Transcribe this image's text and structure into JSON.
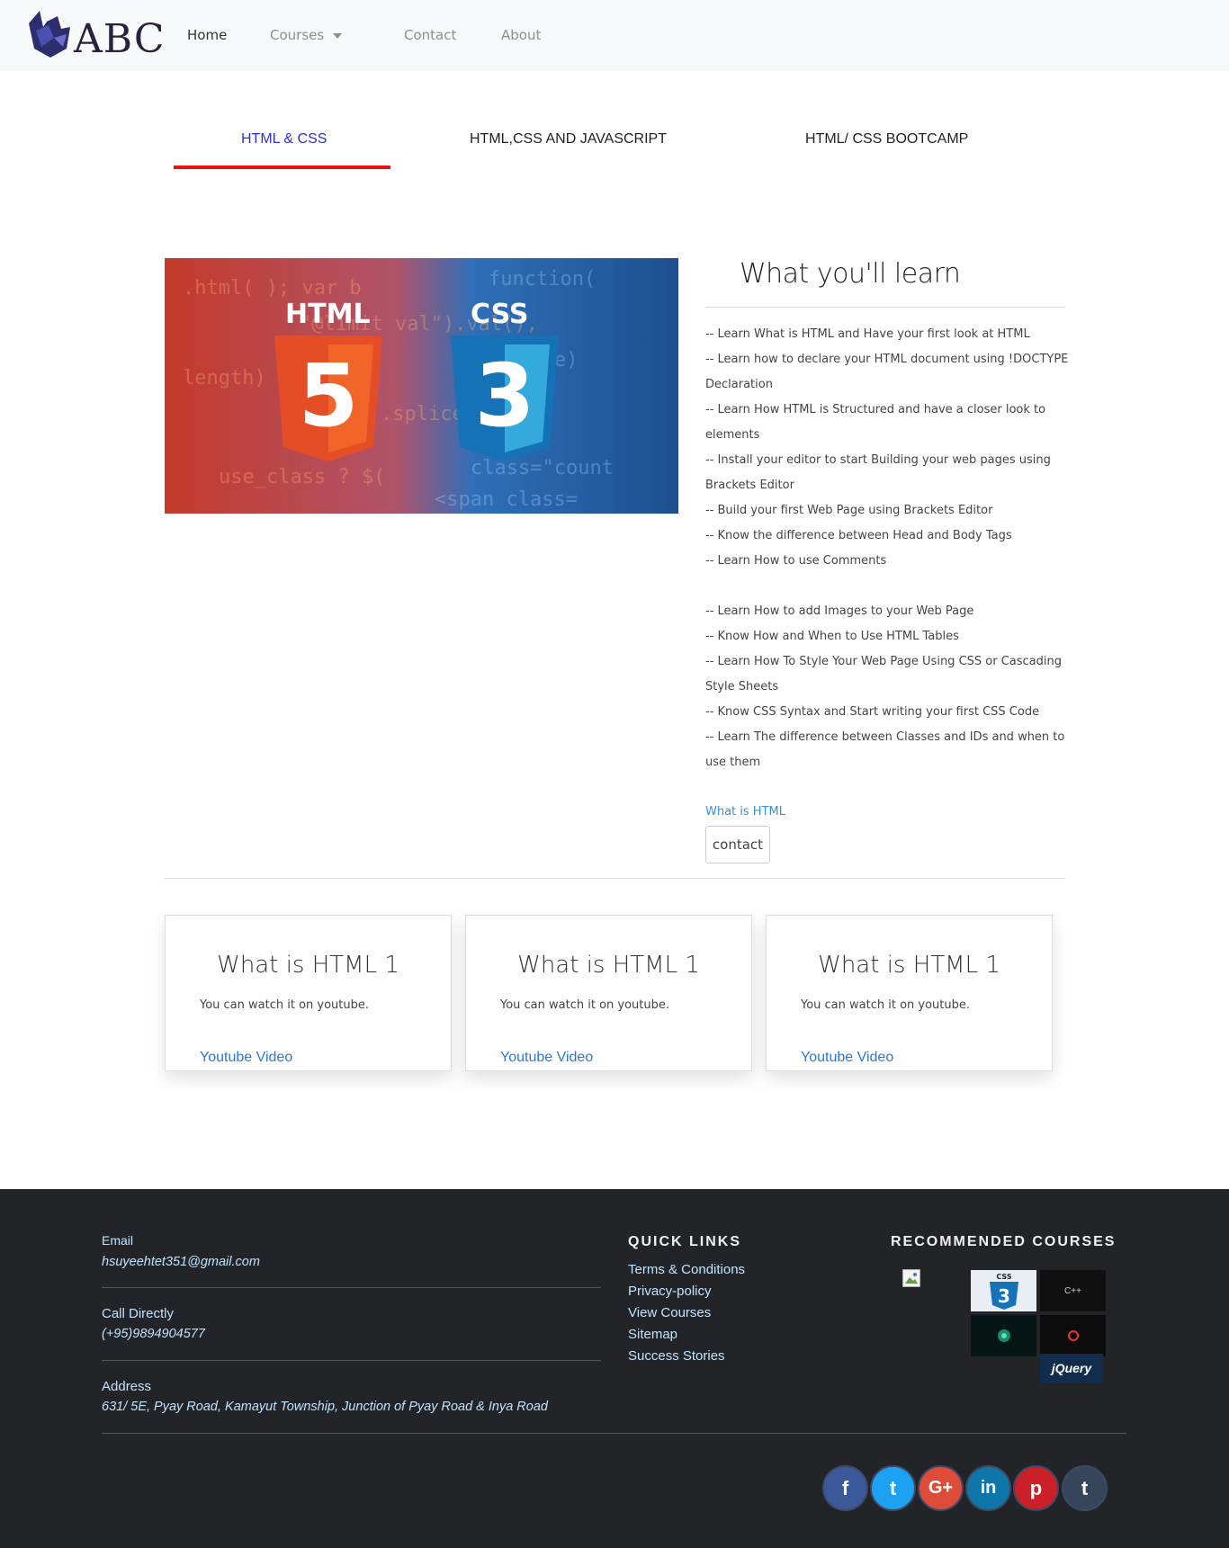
{
  "nav": {
    "logo_text": "ABC",
    "home": "Home",
    "courses": "Courses",
    "contact": "Contact",
    "about": "About"
  },
  "tabs": [
    {
      "label": "HTML & CSS",
      "active": true
    },
    {
      "label": "HTML,CSS AND JAVASCRIPT",
      "active": false
    },
    {
      "label": "HTML/ CSS BOOTCAMP",
      "active": false
    }
  ],
  "hero": {
    "html_label": "HTML",
    "html_num": "5",
    "css_label": "CSS",
    "css_num": "3"
  },
  "learn": {
    "title": "What you'll learn",
    "items": [
      "-- Learn What is HTML and Have your first look at HTML",
      "-- Learn how to declare your HTML document using !DOCTYPE Declaration",
      "-- Learn How HTML is Structured and have a closer look to elements",
      "-- Install your editor to start Building your web pages using Brackets Editor",
      "-- Build your first Web Page using Brackets Editor",
      "-- Know the difference between Head and Body Tags",
      "-- Learn How to use Comments",
      "-- Learn How to add Images to your Web Page",
      "-- Know How and When to Use HTML Tables",
      "-- Learn How To Style Your Web Page Using CSS or Cascading Style Sheets",
      "-- Know CSS Syntax and Start writing your first CSS Code",
      "-- Learn The difference between Classes and IDs and when to use them"
    ],
    "link": "What is HTML",
    "contact_button": "contact"
  },
  "cards": [
    {
      "title": "What is HTML 1",
      "text": "You can watch it on youtube.",
      "link": "Youtube Video"
    },
    {
      "title": "What is HTML 1",
      "text": "You can watch it on youtube.",
      "link": "Youtube Video"
    },
    {
      "title": "What is HTML 1",
      "text": "You can watch it on youtube.",
      "link": "Youtube Video"
    }
  ],
  "footer": {
    "email_label": "Email",
    "email": "hsuyeehtet351@gmail.com",
    "call_label": "Call Directly",
    "phone": "(+95)9894904577",
    "address_label": "Address",
    "address": "631/ 5E, Pyay Road, Kamayut Township, Junction of Pyay Road & Inya Road",
    "quick_links_heading": "QUICK LINKS",
    "quick_links": [
      "Terms & Conditions",
      "Privacy-policy",
      "View Courses",
      "Sitemap",
      "Success Stories"
    ],
    "recommended_heading": "RECOMMENDED COURSES",
    "thumbs": [
      {
        "icon": "css3-icon",
        "text": "CSS",
        "num": "3"
      },
      {
        "icon": "cpp-icon",
        "text": "C++"
      },
      {
        "icon": "android-icon",
        "text": ""
      },
      {
        "icon": "red-logo-icon",
        "text": ""
      },
      {
        "icon": "jquery-icon",
        "text": "jQuery"
      }
    ],
    "social": [
      {
        "icon": "facebook-icon",
        "glyph": "f",
        "color": "#3b5998"
      },
      {
        "icon": "twitter-icon",
        "glyph": "t",
        "color": "#1da1f2"
      },
      {
        "icon": "google-plus-icon",
        "glyph": "G+",
        "color": "#dd4b39"
      },
      {
        "icon": "linkedin-icon",
        "glyph": "in",
        "color": "#0e76a8"
      },
      {
        "icon": "pinterest-icon",
        "glyph": "p",
        "color": "#cb2027"
      },
      {
        "icon": "tumblr-icon",
        "glyph": "t",
        "color": "#35465c"
      }
    ]
  }
}
